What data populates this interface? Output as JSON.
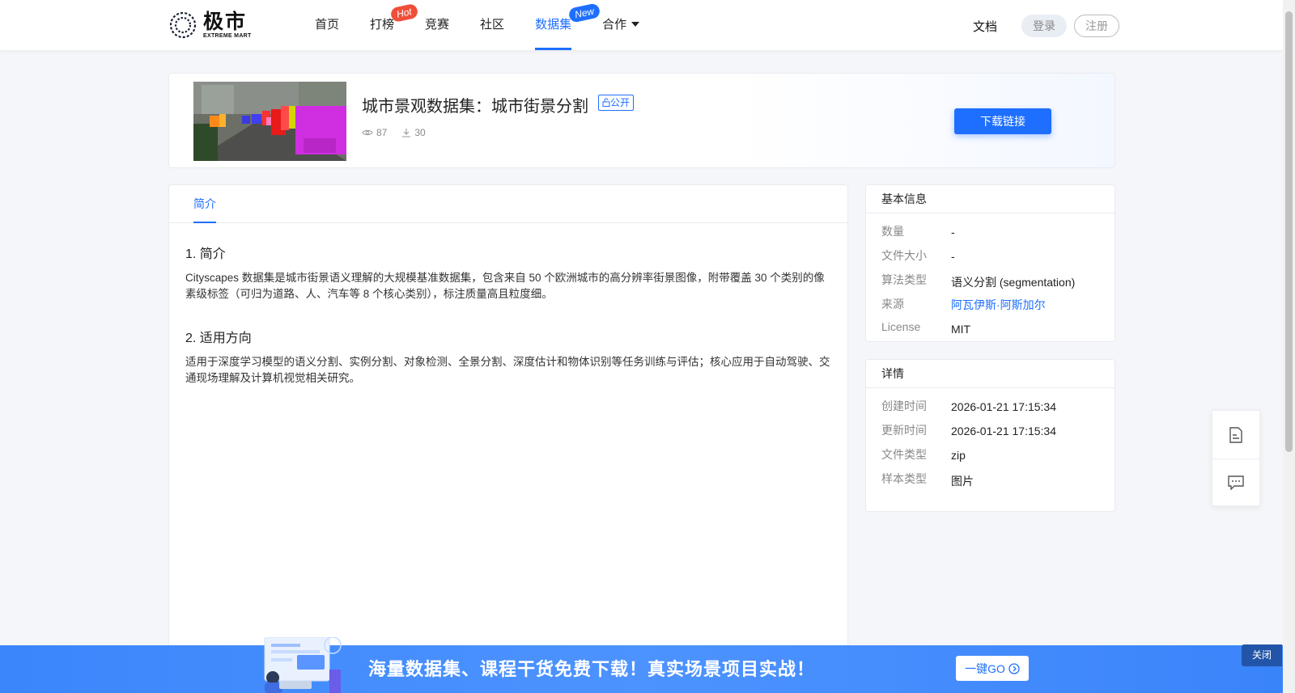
{
  "header": {
    "logo_cn": "极市",
    "logo_en": "EXTREME MART",
    "nav": [
      {
        "label": "首页"
      },
      {
        "label": "打榜",
        "badge": "Hot"
      },
      {
        "label": "竞赛"
      },
      {
        "label": "社区"
      },
      {
        "label": "数据集",
        "badge": "New",
        "active": true
      },
      {
        "label": "合作"
      }
    ],
    "docs": "文档",
    "login": "登录",
    "register": "注册"
  },
  "dataset": {
    "title": "城市景观数据集：城市街景分割",
    "visibility": "公开",
    "views": "87",
    "downloads": "30",
    "download_button": "下载链接"
  },
  "tabs": [
    {
      "label": "简介",
      "active": true
    }
  ],
  "intro": {
    "sections": [
      {
        "heading": "1. 简介",
        "body": "Cityscapes 数据集是城市街景语义理解的大规模基准数据集，包含来自 50 个欧洲城市的高分辨率街景图像，附带覆盖 30 个类别的像素级标签（可归为道路、人、汽车等 8 个核心类别），标注质量高且粒度细。"
      },
      {
        "heading": "2. 适用方向",
        "body": "适用于深度学习模型的语义分割、实例分割、对象检测、全景分割、深度估计和物体识别等任务训练与评估；核心应用于自动驾驶、交通现场理解及计算机视觉相关研究。"
      }
    ]
  },
  "basic_info": {
    "title": "基本信息",
    "rows": [
      {
        "key": "数量",
        "value": "-"
      },
      {
        "key": "文件大小",
        "value": "-"
      },
      {
        "key": "算法类型",
        "value": "语义分割 (segmentation)"
      },
      {
        "key": "来源",
        "value": "阿瓦伊斯·阿斯加尔",
        "link": true
      },
      {
        "key": "License",
        "value": "MIT"
      }
    ]
  },
  "details": {
    "title": "详情",
    "rows": [
      {
        "key": "创建时间",
        "value": "2026-01-21 17:15:34"
      },
      {
        "key": "更新时间",
        "value": "2026-01-21 17:15:34"
      },
      {
        "key": "文件类型",
        "value": "zip"
      },
      {
        "key": "样本类型",
        "value": "图片"
      }
    ]
  },
  "promo": {
    "text": "海量数据集、课程干货免费下载！真实场景项目实战！",
    "go": "一键GO",
    "close": "关闭"
  },
  "colors": {
    "accent": "#1e6fff",
    "hot_badge": "#f04e3a",
    "promo_bg": "#3b86fb"
  },
  "icons": {
    "views": "eye-icon",
    "downloads": "download-icon",
    "public": "lock-open-icon",
    "float1": "document-icon",
    "float2": "chat-icon",
    "go": "arrow-circle-icon"
  }
}
